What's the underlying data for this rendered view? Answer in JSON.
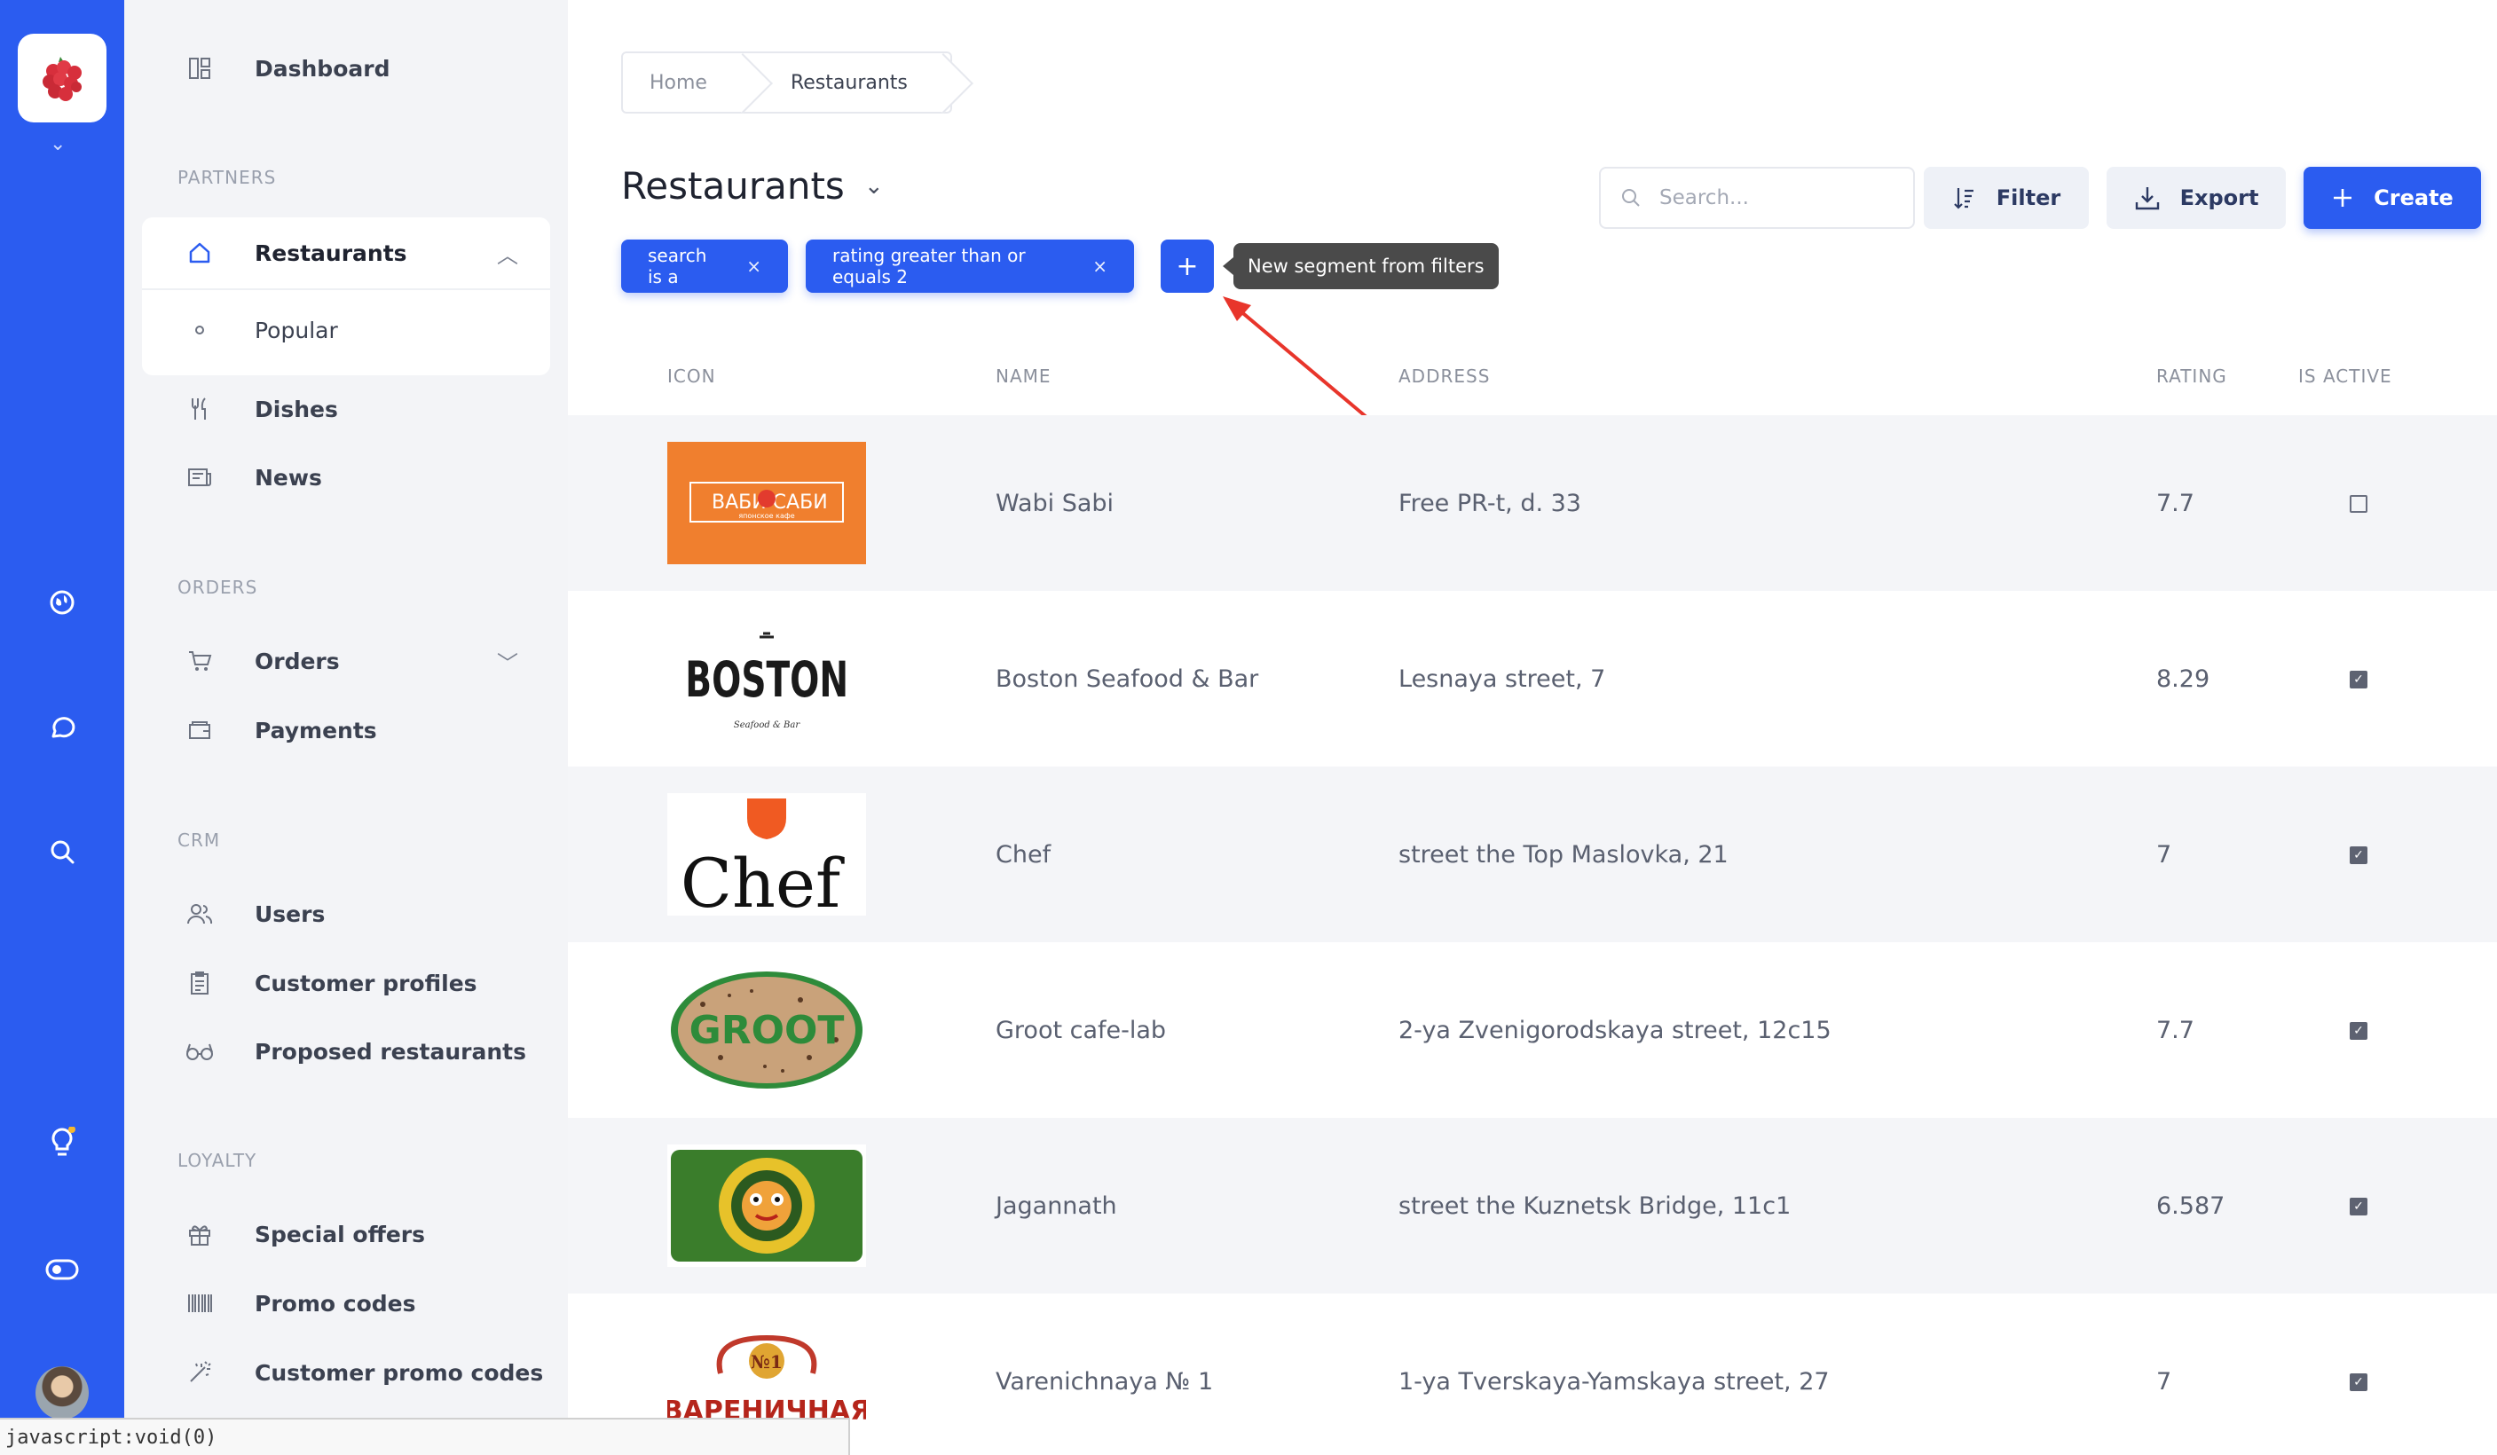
{
  "sidebar": {
    "items": [
      {
        "label": "Dashboard",
        "icon": "dashboard-icon"
      },
      {
        "label": "Restaurants",
        "icon": "home-icon"
      },
      {
        "label": "Popular",
        "icon": "dot-icon"
      },
      {
        "label": "Dishes",
        "icon": "cutlery-icon"
      },
      {
        "label": "News",
        "icon": "news-icon"
      },
      {
        "label": "Orders",
        "icon": "cart-icon"
      },
      {
        "label": "Payments",
        "icon": "wallet-icon"
      },
      {
        "label": "Users",
        "icon": "users-icon"
      },
      {
        "label": "Customer profiles",
        "icon": "clipboard-icon"
      },
      {
        "label": "Proposed restaurants",
        "icon": "glasses-icon"
      },
      {
        "label": "Special offers",
        "icon": "gift-icon"
      },
      {
        "label": "Promo codes",
        "icon": "barcode-icon"
      },
      {
        "label": "Customer promo codes",
        "icon": "magic-icon"
      }
    ],
    "sections": [
      "PARTNERS",
      "ORDERS",
      "CRM",
      "LOYALTY"
    ]
  },
  "breadcrumb": [
    "Home",
    "Restaurants"
  ],
  "page": {
    "title": "Restaurants",
    "search_placeholder": "Search...",
    "filter_label": "Filter",
    "export_label": "Export",
    "create_label": "Create"
  },
  "filters": {
    "chips": [
      "search is a",
      "rating greater than or equals 2"
    ],
    "add_label": "+",
    "tooltip": "New segment from filters"
  },
  "table": {
    "headers": [
      "ICON",
      "NAME",
      "ADDRESS",
      "RATING",
      "IS ACTIVE"
    ],
    "rows": [
      {
        "name": "Wabi Sabi",
        "address": "Free PR-t, d. 33",
        "rating": "7.7",
        "active": false
      },
      {
        "name": "Boston Seafood & Bar",
        "address": "Lesnaya street, 7",
        "rating": "8.29",
        "active": true
      },
      {
        "name": "Chef",
        "address": "street the Top Maslovka, 21",
        "rating": "7",
        "active": true
      },
      {
        "name": "Groot cafe-lab",
        "address": "2-ya Zvenigorodskaya street, 12c15",
        "rating": "7.7",
        "active": true
      },
      {
        "name": "Jagannath",
        "address": "street the Kuznetsk Bridge, 11c1",
        "rating": "6.587",
        "active": true
      },
      {
        "name": "Varenichnaya № 1",
        "address": "1-ya Tverskaya-Yamskaya street, 27",
        "rating": "7",
        "active": true
      }
    ],
    "logos": {
      "wabi_main": "ВАБИ САБИ",
      "wabi_sub": "японское кафе",
      "boston_main": "BOSTON",
      "boston_sub": "Seafood & Bar",
      "chef": "Chef",
      "groot": "GROOT",
      "varenichnaya_num": "№1",
      "varenichnaya_main": "ВАРЕНИЧНАЯ"
    }
  },
  "status_bar": "javascript:void(0)",
  "colors": {
    "accent": "#2b5cf0",
    "sidebar_bg": "#f3f4f7",
    "notification": "#f5b82e",
    "annotation": "#e8352b"
  }
}
